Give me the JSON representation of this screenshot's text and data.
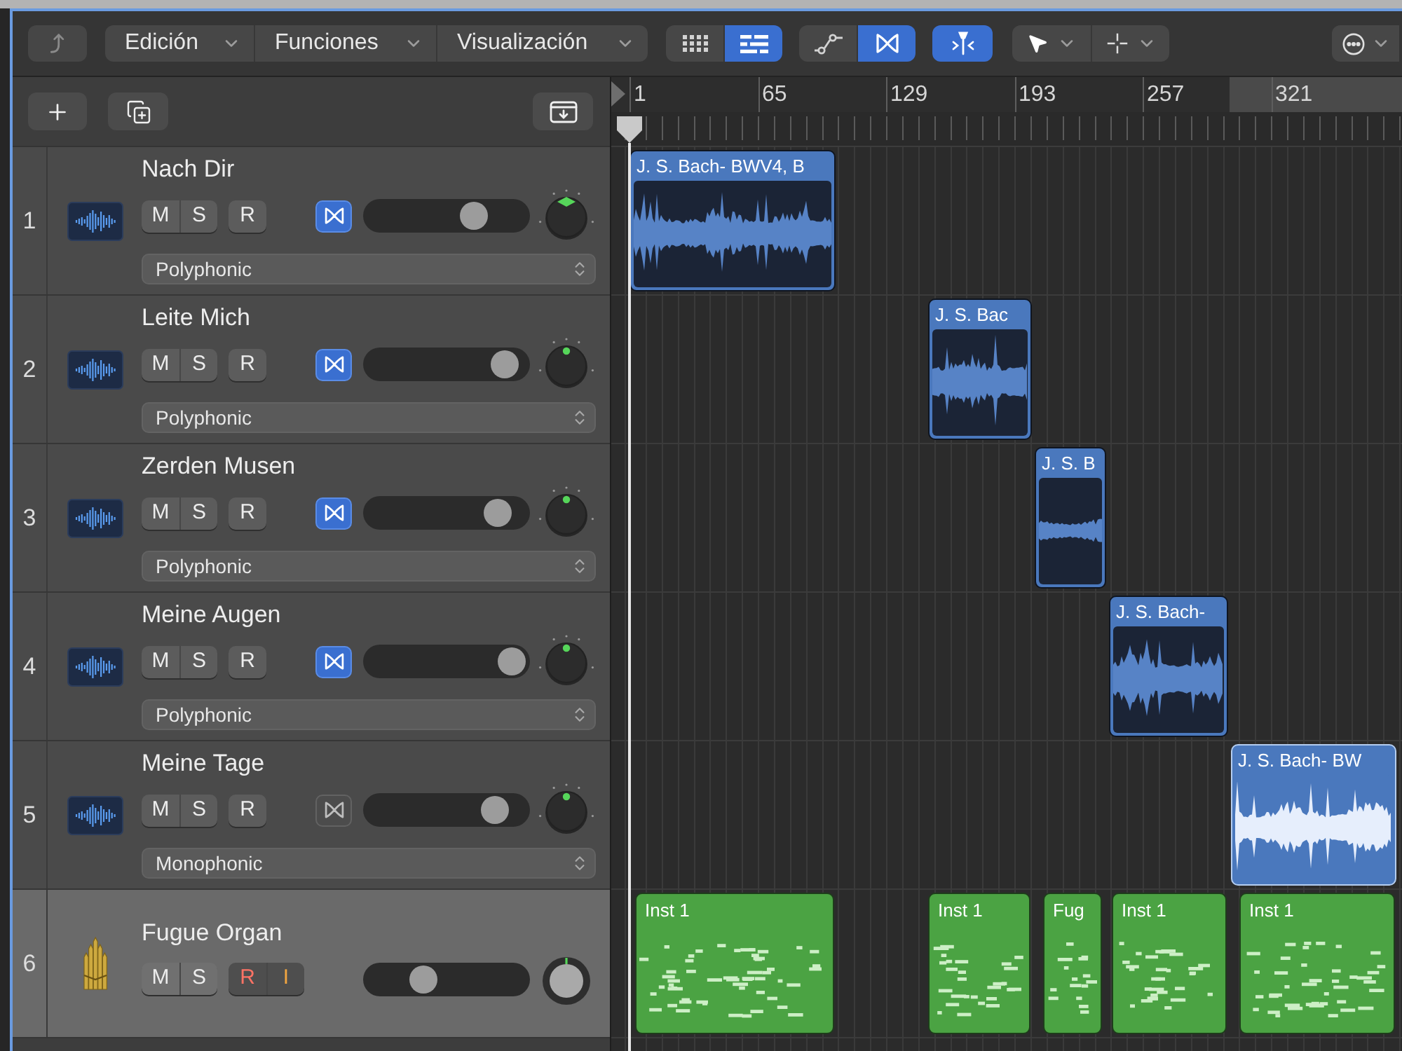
{
  "toolbar": {
    "menus": [
      {
        "label": "Edición"
      },
      {
        "label": "Funciones"
      },
      {
        "label": "Visualización"
      }
    ],
    "view_buttons": [
      {
        "kind": "grid",
        "selected": false
      },
      {
        "kind": "list",
        "selected": true
      }
    ],
    "mode_buttons": [
      {
        "kind": "automation",
        "selected": false
      },
      {
        "kind": "flex",
        "selected": true
      }
    ],
    "catch": {
      "on": true
    },
    "tools": [
      {
        "kind": "pointer"
      },
      {
        "kind": "crosshair"
      }
    ]
  },
  "ruler": {
    "marks": [
      "1",
      "65",
      "129",
      "193",
      "257",
      "321"
    ]
  },
  "tracks": [
    {
      "number": "1",
      "name": "Nach Dir",
      "kind": "audio",
      "selected": false,
      "mute": {
        "label": "M",
        "on": false
      },
      "solo": {
        "label": "S",
        "on": false
      },
      "record": {
        "label": "R",
        "on": false
      },
      "flex": true,
      "volume": {
        "level": 0.71
      },
      "stereo": true,
      "mode": "Polyphonic",
      "regions": [
        {
          "label": "J. S. Bach- BWV4, B",
          "selected": false
        }
      ]
    },
    {
      "number": "2",
      "name": "Leite Mich",
      "kind": "audio",
      "selected": false,
      "mute": {
        "label": "M",
        "on": false
      },
      "solo": {
        "label": "S",
        "on": false
      },
      "record": {
        "label": "R",
        "on": false
      },
      "flex": true,
      "volume": {
        "level": 0.94
      },
      "stereo": false,
      "mode": "Polyphonic",
      "regions": [
        {
          "label": "J. S. Bac",
          "selected": false
        }
      ]
    },
    {
      "number": "3",
      "name": "Zerden Musen",
      "kind": "audio",
      "selected": false,
      "mute": {
        "label": "M",
        "on": false
      },
      "solo": {
        "label": "S",
        "on": false
      },
      "record": {
        "label": "R",
        "on": false
      },
      "flex": true,
      "volume": {
        "level": 0.88
      },
      "stereo": false,
      "mode": "Polyphonic",
      "regions": [
        {
          "label": "J. S. B",
          "selected": false
        }
      ]
    },
    {
      "number": "4",
      "name": "Meine Augen",
      "kind": "audio",
      "selected": false,
      "mute": {
        "label": "M",
        "on": false
      },
      "solo": {
        "label": "S",
        "on": false
      },
      "record": {
        "label": "R",
        "on": false
      },
      "flex": true,
      "volume": {
        "level": 0.99
      },
      "stereo": false,
      "mode": "Polyphonic",
      "regions": [
        {
          "label": "J. S. Bach-",
          "selected": false
        }
      ]
    },
    {
      "number": "5",
      "name": "Meine Tage",
      "kind": "audio",
      "selected": false,
      "mute": {
        "label": "M",
        "on": false
      },
      "solo": {
        "label": "S",
        "on": false
      },
      "record": {
        "label": "R",
        "on": false
      },
      "flex": false,
      "volume": {
        "level": 0.86
      },
      "stereo": false,
      "mode": "Monophonic",
      "regions": [
        {
          "label": "J. S. Bach- BW",
          "selected": true
        }
      ]
    },
    {
      "number": "6",
      "name": "Fugue Organ",
      "kind": "instrument",
      "selected": true,
      "mute": {
        "label": "M",
        "on": false
      },
      "solo": {
        "label": "S",
        "on": false
      },
      "record": {
        "label": "R",
        "on": true
      },
      "input": {
        "label": "I",
        "on": true
      },
      "volume": {
        "level": 0.33
      },
      "regions": [
        {
          "label": "Inst 1",
          "selected": false
        },
        {
          "label": "Inst 1",
          "selected": false
        },
        {
          "label": "Fug",
          "selected": false
        },
        {
          "label": "Inst 1",
          "selected": false
        },
        {
          "label": "Inst 1",
          "selected": false
        }
      ]
    }
  ]
}
